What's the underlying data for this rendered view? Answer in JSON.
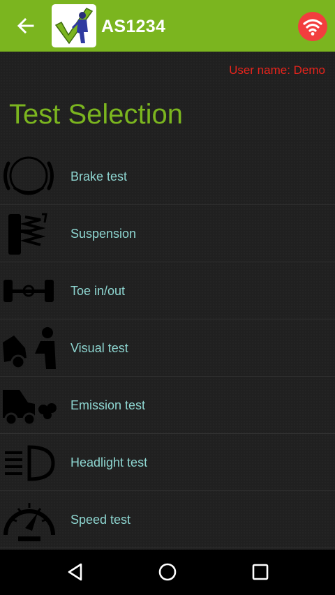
{
  "appbar": {
    "title": "AS1234",
    "back_icon": "arrow-left-icon",
    "wifi_icon": "wifi-icon",
    "accent_color": "#7bb51f",
    "wifi_badge_color": "#f23e3e"
  },
  "header": {
    "user_name": "User name: Demo",
    "page_title": "Test Selection"
  },
  "tests": [
    {
      "label": "Brake test",
      "icon": "brake-icon"
    },
    {
      "label": "Suspension",
      "icon": "suspension-icon"
    },
    {
      "label": "Toe in/out",
      "icon": "axle-icon"
    },
    {
      "label": "Visual test",
      "icon": "visual-inspection-icon"
    },
    {
      "label": "Emission test",
      "icon": "emission-icon"
    },
    {
      "label": "Headlight test",
      "icon": "headlight-icon"
    },
    {
      "label": "Speed test",
      "icon": "speedometer-icon"
    }
  ],
  "navbar": {
    "back_icon": "nav-back-icon",
    "home_icon": "nav-home-icon",
    "recents_icon": "nav-recents-icon"
  }
}
